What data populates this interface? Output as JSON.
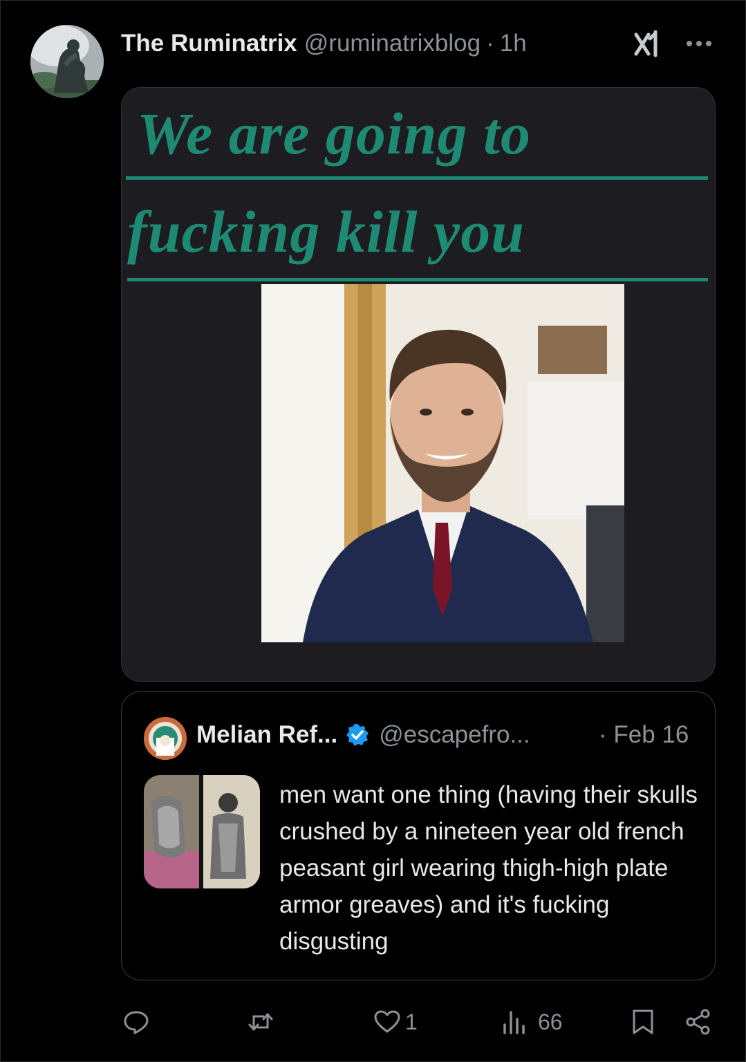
{
  "tweet": {
    "author_name": "The Ruminatrix",
    "author_handle": "@ruminatrixblog",
    "separator": "·",
    "time": "1h",
    "media": {
      "text_line_1": "We are going to",
      "text_line_2": "fucking kill you",
      "text_color": "#1f8a74"
    },
    "header_icons": [
      "grok-icon",
      "more-icon"
    ]
  },
  "quoted": {
    "author_name": "Melian Ref...",
    "author_handle": "@escapefro...",
    "date": "· Feb 16",
    "verified_color": "#1d9bf0",
    "text": "men want one thing (having their skulls crushed by a nineteen year old french peasant girl wearing thigh-high plate armor greaves) and it's fucking disgusting"
  },
  "actions": {
    "reply_count": "",
    "repost_count": "",
    "like_count": "1",
    "views_count": "66",
    "icons": [
      "reply-icon",
      "repost-icon",
      "like-icon",
      "views-icon",
      "bookmark-icon",
      "share-icon"
    ]
  }
}
